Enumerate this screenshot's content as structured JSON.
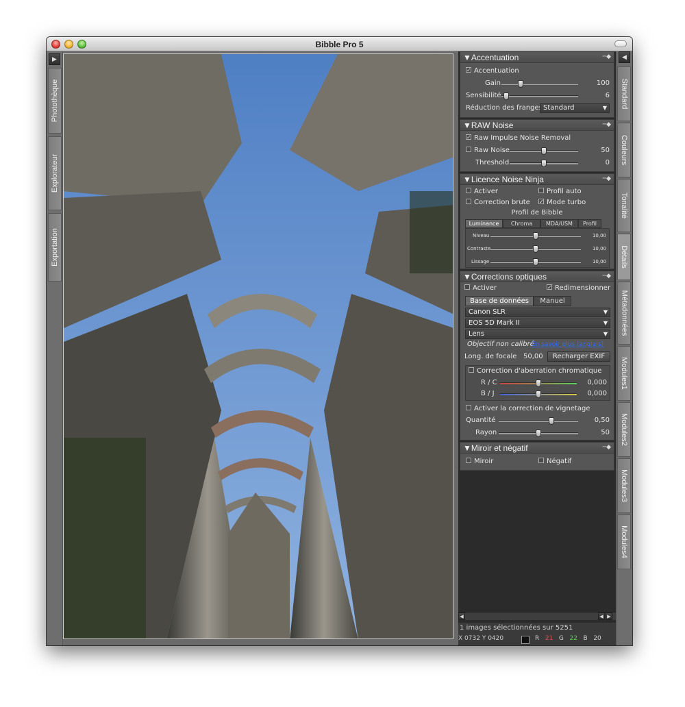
{
  "window": {
    "title": "Bibble Pro 5"
  },
  "left_tabs": [
    "Photothèque",
    "Explorateur",
    "Exportation"
  ],
  "right_tabs": [
    "Standard",
    "Couleurs",
    "Tonalité",
    "Détails",
    "Métadonnées",
    "Modules1",
    "Modules2",
    "Modules3",
    "Modules4"
  ],
  "accentuation": {
    "header": "Accentuation",
    "enable_label": "Accentuation",
    "gain_label": "Gain",
    "gain_value": "100",
    "gain_level": 0.25,
    "sens_label": "Sensibilité",
    "sens_value": "6",
    "sens_level": 0.06,
    "fringe_label": "Réduction des franges",
    "fringe_value": "Standard"
  },
  "raw_noise": {
    "header": "RAW Noise",
    "impulse_label": "Raw Impulse Noise Removal",
    "noise_label": "Raw Noise",
    "noise_value": "50",
    "noise_level": 0.5,
    "threshold_label": "Threshold",
    "threshold_value": "0",
    "threshold_level": 0.5
  },
  "noise_ninja": {
    "header": "Licence Noise Ninja",
    "activer": "Activer",
    "profil_auto": "Profil auto",
    "correction_brute": "Correction brute",
    "mode_turbo": "Mode turbo",
    "profil_title": "Profil de Bibble",
    "tabs": [
      "Luminance",
      "Chroma",
      "MDA/USM",
      "Profil"
    ],
    "niveau_label": "Niveau",
    "niveau_value": "10,00",
    "niveau_level": 0.5,
    "contraste_label": "Contraste",
    "contraste_value": "10,00",
    "contraste_level": 0.5,
    "lissage_label": "Lissage",
    "lissage_value": "10,00",
    "lissage_level": 0.5
  },
  "optics": {
    "header": "Corrections optiques",
    "activer": "Activer",
    "redim": "Redimensionner",
    "tab_db": "Base de données",
    "tab_manual": "Manuel",
    "camera": "Canon SLR",
    "model": "EOS 5D Mark II",
    "lens": "Lens",
    "uncal_text": "Objectif non calibré",
    "uncal_link": "En savoir plus (anglais)",
    "focal_label": "Long. de focale",
    "focal_value": "50,00",
    "reload_btn": "Recharger EXIF",
    "ca_label": "Correction d'aberration chromatique",
    "rc_label": "R / C",
    "rc_value": "0,000",
    "rc_level": 0.5,
    "bj_label": "B / J",
    "bj_value": "0,000",
    "bj_level": 0.5,
    "vign_label": "Activer la correction de vignetage",
    "qty_label": "Quantité",
    "qty_value": "0,50",
    "qty_level": 0.66,
    "rayon_label": "Rayon",
    "rayon_value": "50",
    "rayon_level": 0.5
  },
  "mirror": {
    "header": "Miroir et négatif",
    "miroir": "Miroir",
    "negatif": "Négatif"
  },
  "status": {
    "selection": "1 images sélectionnées sur 5251",
    "x_label": "X",
    "x": "0732",
    "y_label": "Y",
    "y": "0420",
    "r_label": "R",
    "r": "21",
    "g_label": "G",
    "g": "22",
    "b_label": "B",
    "b": "20"
  },
  "colors": {
    "panel_bg": "#2b2b2b",
    "section_bg": "#565656",
    "sky": "#5b86c4",
    "stone": "#8a8780",
    "r_value": "#e05050",
    "g_value": "#5fcf5f",
    "link": "#2a6cff"
  }
}
